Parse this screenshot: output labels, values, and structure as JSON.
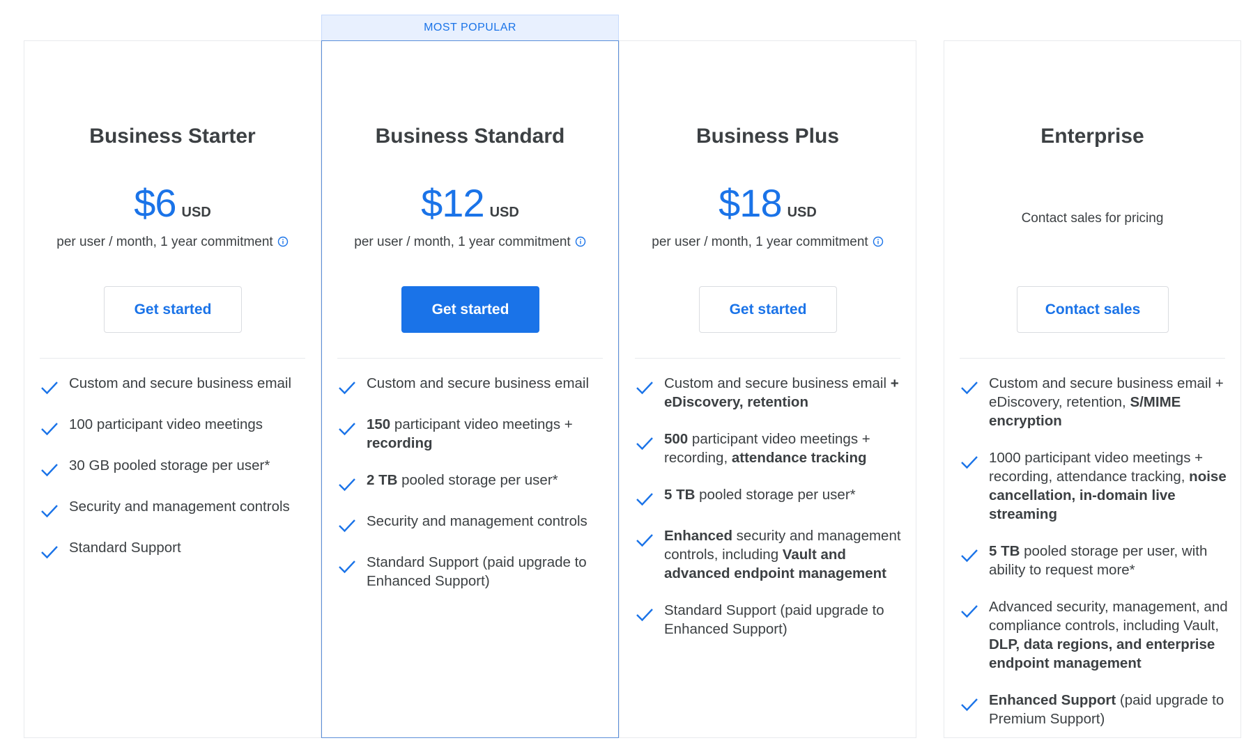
{
  "badge": "MOST POPULAR",
  "colors": {
    "accent": "#1a73e8",
    "text": "#3c4043",
    "border": "#e8eaed",
    "badge_bg": "#e8f0fe"
  },
  "plans": [
    {
      "name": "Business Starter",
      "price": "$6",
      "currency": "USD",
      "price_note": "per user / month, 1 year commitment",
      "button": "Get started",
      "features": [
        [
          {
            "t": "Custom and secure business email",
            "b": false
          }
        ],
        [
          {
            "t": "100 participant video meetings",
            "b": false
          }
        ],
        [
          {
            "t": "30 GB pooled storage per user*",
            "b": false
          }
        ],
        [
          {
            "t": "Security and management controls",
            "b": false
          }
        ],
        [
          {
            "t": "Standard Support",
            "b": false
          }
        ]
      ]
    },
    {
      "name": "Business Standard",
      "price": "$12",
      "currency": "USD",
      "price_note": "per user / month, 1 year commitment",
      "button": "Get started",
      "features": [
        [
          {
            "t": "Custom and secure business email",
            "b": false
          }
        ],
        [
          {
            "t": "150",
            "b": true
          },
          {
            "t": " participant video meetings + ",
            "b": false
          },
          {
            "t": "recording",
            "b": true
          }
        ],
        [
          {
            "t": "2 TB",
            "b": true
          },
          {
            "t": " pooled storage per user*",
            "b": false
          }
        ],
        [
          {
            "t": "Security and management controls",
            "b": false
          }
        ],
        [
          {
            "t": "Standard Support (paid upgrade to Enhanced Support)",
            "b": false
          }
        ]
      ]
    },
    {
      "name": "Business Plus",
      "price": "$18",
      "currency": "USD",
      "price_note": "per user / month, 1 year commitment",
      "button": "Get started",
      "features": [
        [
          {
            "t": "Custom and secure business email ",
            "b": false
          },
          {
            "t": "+ eDiscovery, retention",
            "b": true
          }
        ],
        [
          {
            "t": "500",
            "b": true
          },
          {
            "t": " participant video meetings + recording, ",
            "b": false
          },
          {
            "t": "attendance tracking",
            "b": true
          }
        ],
        [
          {
            "t": "5 TB",
            "b": true
          },
          {
            "t": " pooled storage per user*",
            "b": false
          }
        ],
        [
          {
            "t": "Enhanced",
            "b": true
          },
          {
            "t": " security and management controls, including ",
            "b": false
          },
          {
            "t": "Vault and advanced endpoint management",
            "b": true
          }
        ],
        [
          {
            "t": "Standard Support (paid upgrade to Enhanced Support)",
            "b": false
          }
        ]
      ]
    },
    {
      "name": "Enterprise",
      "contact_note": "Contact sales for pricing",
      "button": "Contact sales",
      "features": [
        [
          {
            "t": "Custom and secure business email + eDiscovery, retention, ",
            "b": false
          },
          {
            "t": "S/MIME encryption",
            "b": true
          }
        ],
        [
          {
            "t": "1000 participant video meetings + recording, attendance tracking, ",
            "b": false
          },
          {
            "t": "noise cancellation, in-domain live streaming",
            "b": true
          }
        ],
        [
          {
            "t": "5 TB",
            "b": true
          },
          {
            "t": " pooled storage per user, with ability to request more*",
            "b": false
          }
        ],
        [
          {
            "t": "Advanced security, management, and compliance controls, including Vault, ",
            "b": false
          },
          {
            "t": "DLP, data regions, and enterprise endpoint management",
            "b": true
          }
        ],
        [
          {
            "t": "Enhanced Support",
            "b": true
          },
          {
            "t": " (paid upgrade to Premium Support)",
            "b": false
          }
        ]
      ]
    }
  ]
}
